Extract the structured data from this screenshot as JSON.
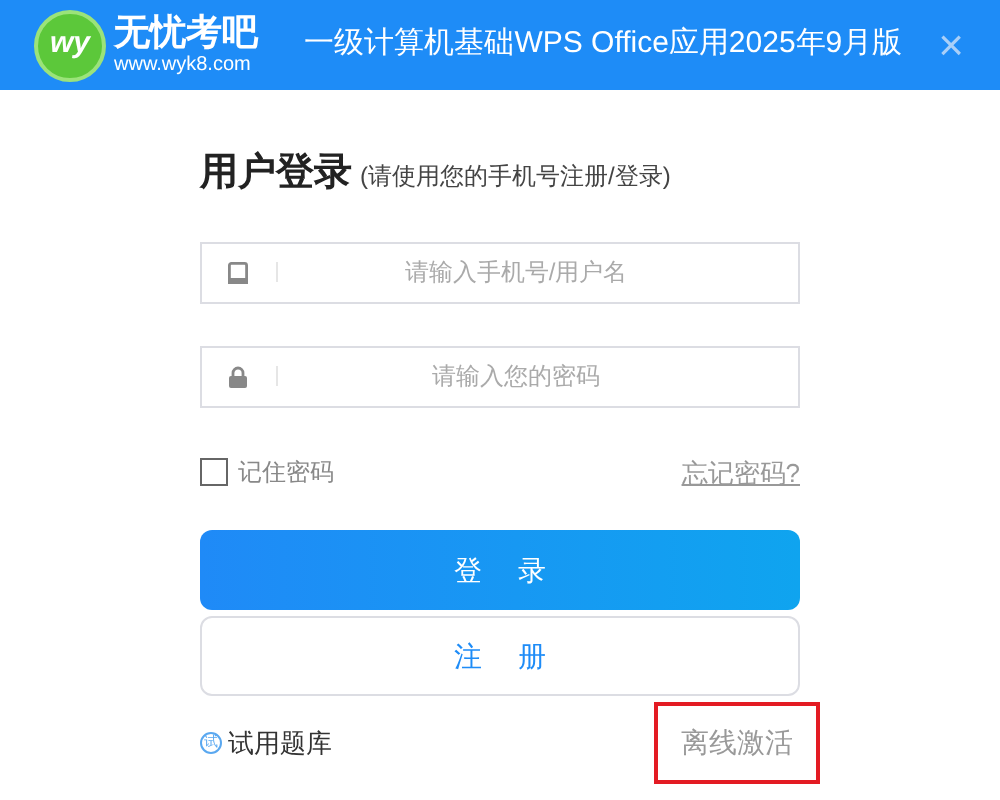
{
  "header": {
    "logo_mark": "wy",
    "logo_name": "无忧考吧",
    "logo_url": "www.wyk8.com",
    "title": "一级计算机基础WPS Office应用2025年9月版",
    "close": "×"
  },
  "login": {
    "heading": "用户登录",
    "subheading": "(请使用您的手机号注册/登录)",
    "fields": [
      {
        "kind": "phone",
        "placeholder": "请输入手机号/用户名"
      },
      {
        "kind": "password",
        "placeholder": "请输入您的密码"
      }
    ],
    "remember": {
      "label": "记住密码",
      "checked": false
    },
    "forgot": "忘记密码?",
    "buttons": [
      {
        "kind": "primary",
        "label": "登 录"
      },
      {
        "kind": "outline",
        "label": "注 册"
      }
    ],
    "trial": {
      "icon_text": "试",
      "label": "试用题库"
    },
    "offline": {
      "label": "离线激活",
      "highlighted": true
    }
  }
}
